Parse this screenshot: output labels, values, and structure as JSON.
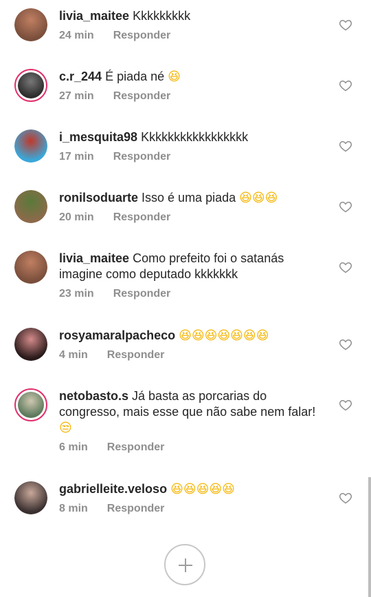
{
  "comments": [
    {
      "user": "livia_maitee",
      "text": "Kkkkkkkkk",
      "emoji": "",
      "time": "24 min",
      "reply": "Responder",
      "avatar_colors": [
        "#7a4f3c",
        "#c07f62"
      ],
      "story_ring": false
    },
    {
      "user": "c.r_244",
      "text": "É piada né",
      "emoji": "😆",
      "time": "27 min",
      "reply": "Responder",
      "avatar_colors": [
        "#2c2c2c",
        "#777777"
      ],
      "story_ring": true
    },
    {
      "user": "i_mesquita98",
      "text": "Kkkkkkkkkkkkkkkkk",
      "emoji": "",
      "time": "17 min",
      "reply": "Responder",
      "avatar_colors": [
        "#3aa7d8",
        "#c0392b"
      ],
      "story_ring": false
    },
    {
      "user": "ronilsoduarte",
      "text": "Isso é uma piada",
      "emoji": "😆😆😆",
      "time": "20 min",
      "reply": "Responder",
      "avatar_colors": [
        "#8b6a4a",
        "#5a7a3a"
      ],
      "story_ring": false
    },
    {
      "user": "livia_maitee",
      "text": "Como prefeito foi o satanás imagine como deputado kkkkkkk",
      "emoji": "",
      "time": "23 min",
      "reply": "Responder",
      "avatar_colors": [
        "#7a4f3c",
        "#c07f62"
      ],
      "story_ring": false
    },
    {
      "user": "rosyamaralpacheco",
      "text": "",
      "emoji": "😆😆😆😆😆😆😆",
      "time": "4 min",
      "reply": "Responder",
      "avatar_colors": [
        "#2a1a1a",
        "#d48a8a"
      ],
      "story_ring": false
    },
    {
      "user": "netobasto.s",
      "text": "Já basta as porcarias do congresso, mais esse que não sabe nem falar!",
      "emoji": "😒",
      "time": "6 min",
      "reply": "Responder",
      "avatar_colors": [
        "#5c7a5c",
        "#cfc7b0"
      ],
      "story_ring": true
    },
    {
      "user": "gabrielleite.veloso",
      "text": "",
      "emoji": "😆😆😆😆😆",
      "time": "8 min",
      "reply": "Responder",
      "avatar_colors": [
        "#3a3030",
        "#c9a89a"
      ],
      "story_ring": false
    }
  ],
  "icons": {
    "like": "heart-outline-icon",
    "add": "plus-icon"
  },
  "colors": {
    "muted": "#8e8e8e",
    "text": "#262626",
    "story_ring": "#e1306c",
    "emoji": "#f5b400"
  }
}
